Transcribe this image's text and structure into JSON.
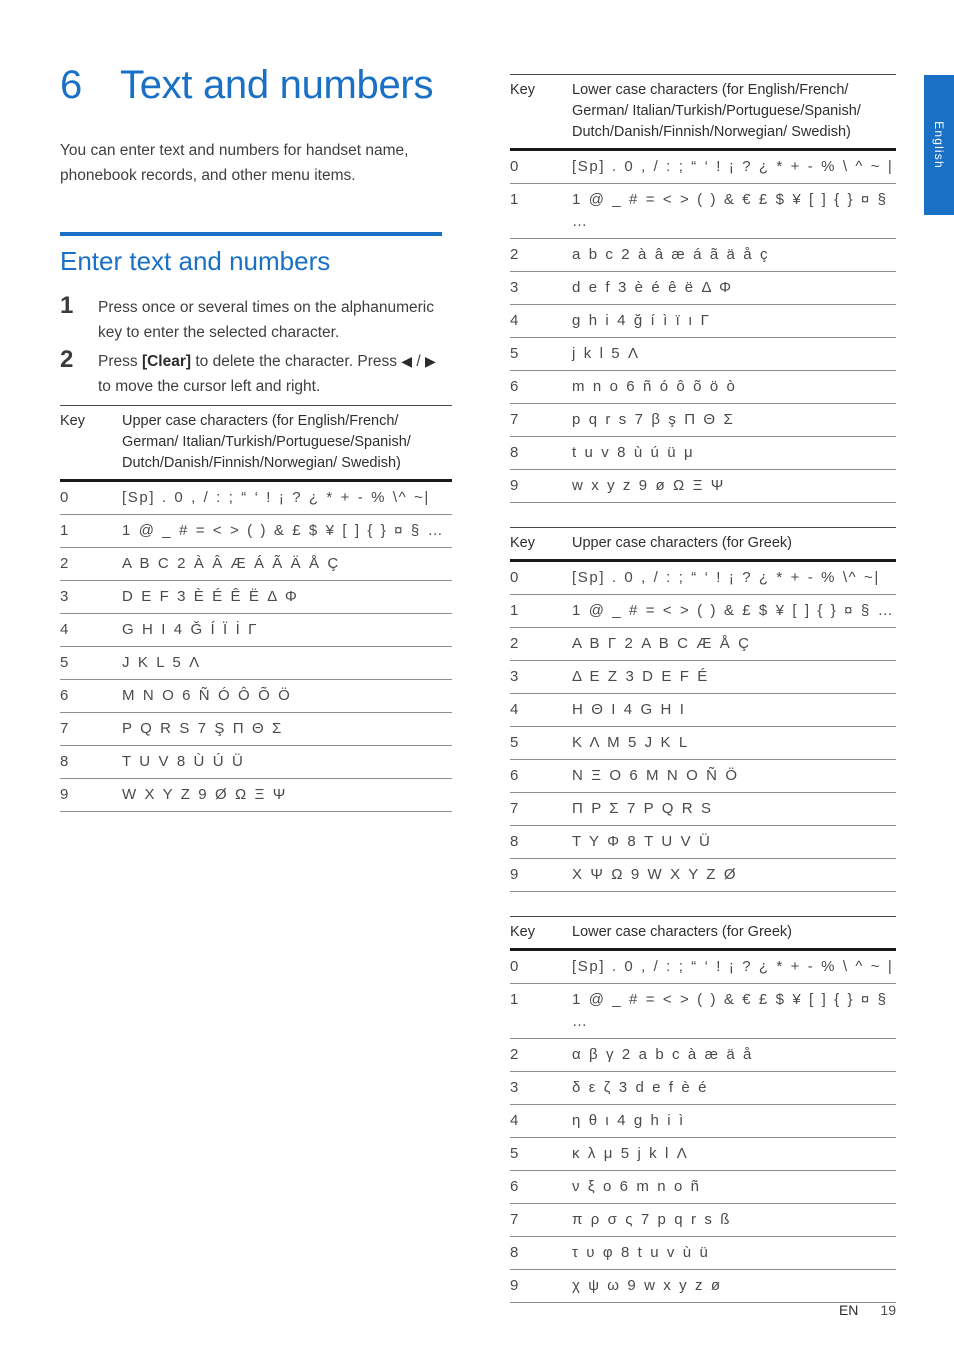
{
  "language_tab": {
    "label": "English"
  },
  "chapter": {
    "number": "6",
    "title": "Text and numbers"
  },
  "intro": "You can enter text and numbers for handset name, phonebook records, and other menu items.",
  "section": {
    "title": "Enter text and numbers"
  },
  "steps": [
    {
      "num": "1",
      "text_before": "Press once or several times on the alphanumeric key to enter the selected character.",
      "bold": "",
      "text_after": ""
    },
    {
      "num": "2",
      "line1_before": "Press ",
      "line1_bold": "[Clear]",
      "line1_after": " to delete the character.",
      "line2_before": "Press ",
      "line2_arrow_left": "◀",
      "line2_slash": " / ",
      "line2_arrow_right": "▶",
      "line2_after": " to move the cursor left and right."
    }
  ],
  "tables": [
    {
      "id": "upper-latin",
      "column": "left",
      "key_header": "Key",
      "chars_header": "Upper case characters (for English/French/ German/ Italian/Turkish/Portuguese/Spanish/ Dutch/Danish/Finnish/Norwegian/ Swedish)",
      "rows": [
        {
          "key": "0",
          "chars": "[Sp] . 0 , / : ; “ ‘ ! ¡ ? ¿ * + - % \\^ ~|"
        },
        {
          "key": "1",
          "chars": "1 @ _ # = < > ( ) & £ $ ¥ [ ] { } ¤ § …"
        },
        {
          "key": "2",
          "chars": "A B C 2 À Â Æ Á Ã Ä Å Ç"
        },
        {
          "key": "3",
          "chars": "D E F 3 È É Ê Ë Δ Φ"
        },
        {
          "key": "4",
          "chars": "G H I 4 Ğ Í Ï İ Γ"
        },
        {
          "key": "5",
          "chars": "J K L 5 Λ"
        },
        {
          "key": "6",
          "chars": "M N O 6 Ñ Ó Ô Õ Ö"
        },
        {
          "key": "7",
          "chars": "P Q R S 7 Ş Π Θ Σ"
        },
        {
          "key": "8",
          "chars": "T U V 8 Ù Ú Ü"
        },
        {
          "key": "9",
          "chars": "W X Y Z 9 Ø Ω Ξ Ψ"
        }
      ]
    },
    {
      "id": "lower-latin",
      "column": "right",
      "key_header": "Key",
      "chars_header": "Lower case characters (for English/French/ German/ Italian/Turkish/Portuguese/Spanish/ Dutch/Danish/Finnish/Norwegian/ Swedish)",
      "rows": [
        {
          "key": "0",
          "chars": "[Sp] . 0 , / : ; “ ‘ ! ¡ ? ¿ * + - % \\ ^ ~ |"
        },
        {
          "key": "1",
          "chars": "1 @ _ # = < > ( ) & € £ $ ¥ [ ] { } ¤ § …"
        },
        {
          "key": "2",
          "chars": "a b c 2 à â æ á ã ä å ç"
        },
        {
          "key": "3",
          "chars": "d e f 3 è é ê ë Δ Φ"
        },
        {
          "key": "4",
          "chars": "g h i 4 ğ í ì ï ı Γ"
        },
        {
          "key": "5",
          "chars": "j k l 5 Λ"
        },
        {
          "key": "6",
          "chars": "m n o 6 ñ ó ô õ ö ò"
        },
        {
          "key": "7",
          "chars": "p q r s 7 β ş Π Θ Σ"
        },
        {
          "key": "8",
          "chars": "t u v 8 ù ú ü μ"
        },
        {
          "key": "9",
          "chars": "w x y z 9 ø Ω Ξ Ψ"
        }
      ]
    },
    {
      "id": "upper-greek",
      "column": "right",
      "key_header": "Key",
      "chars_header": "Upper case characters (for Greek)",
      "rows": [
        {
          "key": "0",
          "chars": "[Sp] . 0 , / : ; “ ‘ ! ¡ ? ¿ * + - % \\^ ~|"
        },
        {
          "key": "1",
          "chars": "1 @ _ # = < > ( ) & £ $ ¥ [ ] { } ¤ § …"
        },
        {
          "key": "2",
          "chars": "Α Β Γ 2 A B C Æ Å Ç"
        },
        {
          "key": "3",
          "chars": "Δ Ε Ζ 3 D E F É"
        },
        {
          "key": "4",
          "chars": "Η Θ Ι 4 G H I"
        },
        {
          "key": "5",
          "chars": "Κ Λ Μ 5 J K L"
        },
        {
          "key": "6",
          "chars": "Ν Ξ Ο 6 M N O Ñ Ö"
        },
        {
          "key": "7",
          "chars": "Π Ρ Σ 7 P Q R S"
        },
        {
          "key": "8",
          "chars": "Τ Υ Φ 8 T U V Ü"
        },
        {
          "key": "9",
          "chars": "Χ Ψ Ω 9 W X Y Z Ø"
        }
      ]
    },
    {
      "id": "lower-greek",
      "column": "right",
      "key_header": "Key",
      "chars_header": "Lower case characters (for Greek)",
      "rows": [
        {
          "key": "0",
          "chars": "[Sp] . 0 , / : ; “ ‘ ! ¡ ? ¿ * + - % \\ ^ ~ |"
        },
        {
          "key": "1",
          "chars": "1 @ _ # = < > ( ) & € £ $ ¥ [ ] { } ¤ § …"
        },
        {
          "key": "2",
          "chars": "α β γ 2 a b c à æ ä å"
        },
        {
          "key": "3",
          "chars": "δ ε ζ 3 d e f è é"
        },
        {
          "key": "4",
          "chars": "η θ ι 4 g h i ì"
        },
        {
          "key": "5",
          "chars": "κ λ μ 5 j k l Λ"
        },
        {
          "key": "6",
          "chars": "ν ξ ο 6 m n o ñ"
        },
        {
          "key": "7",
          "chars": "π ρ σ ς 7 p q r s ß"
        },
        {
          "key": "8",
          "chars": "τ υ φ 8 t u v ù ü"
        },
        {
          "key": "9",
          "chars": "χ ψ ω 9 w x y z ø"
        }
      ]
    }
  ],
  "footer": {
    "lang_code": "EN",
    "page_number": "19"
  },
  "colors": {
    "accent_blue": "#1a70c4",
    "body_text": "#3f3f3f",
    "rule_dark": "#1a1a1a"
  }
}
